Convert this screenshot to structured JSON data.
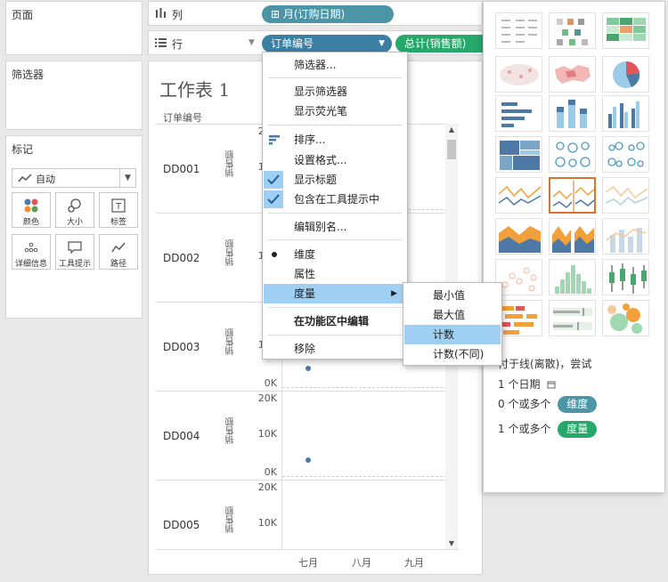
{
  "panels": {
    "pages": "页面",
    "filters": "筛选器",
    "marks": "标记"
  },
  "marks": {
    "type_value": "自动",
    "buttons": [
      {
        "label": "颜色",
        "icon": "color-dots-icon"
      },
      {
        "label": "大小",
        "icon": "size-icon"
      },
      {
        "label": "标签",
        "icon": "label-icon"
      },
      {
        "label": "详细信息",
        "icon": "detail-icon"
      },
      {
        "label": "工具提示",
        "icon": "tooltip-icon"
      },
      {
        "label": "路径",
        "icon": "path-icon"
      }
    ]
  },
  "shelves": {
    "columns_label": "列",
    "rows_label": "行",
    "columns_pill": "⊞ 月(订购日期)",
    "rows_pill": "订单编号",
    "sales_pill": "总计(销售额)"
  },
  "sheet": {
    "title": "工作表 1",
    "row_header": "订单编号",
    "rows": [
      "DD001",
      "DD002",
      "DD003",
      "DD004",
      "DD005"
    ],
    "axis_title": "销售额",
    "axis_ticks": [
      "20K",
      "10K",
      "0K"
    ],
    "months": [
      "七月",
      "八月",
      "九月"
    ]
  },
  "context_menu": {
    "items": [
      {
        "label": "筛选器..."
      },
      {
        "label": "显示筛选器"
      },
      {
        "label": "显示荧光笔"
      },
      {
        "label": "排序..."
      },
      {
        "label": "设置格式..."
      },
      {
        "label": "显示标题",
        "checked": true
      },
      {
        "label": "包含在工具提示中",
        "checked": true
      },
      {
        "label": "编辑别名..."
      },
      {
        "label": "维度",
        "bullet": true
      },
      {
        "label": "属性"
      },
      {
        "label": "度量",
        "submenu": true
      },
      {
        "label": "在功能区中编辑"
      },
      {
        "label": "移除"
      }
    ]
  },
  "sub_menu": {
    "items": [
      "最小值",
      "最大值",
      "计数",
      "计数(不同)"
    ],
    "active_index": 2
  },
  "show_me": {
    "hint_line1": "付于线(离散)，尝试",
    "hint_date": "1 个日期",
    "hint_dims_prefix": "0 个或多个",
    "hint_dims_pill": "维度",
    "hint_meas_prefix": "1 个或多个",
    "hint_meas_pill": "度量"
  },
  "colors": {
    "dimension_pill": "#3b7fa4",
    "measure_pill": "#27a86b",
    "menu_highlight": "#9fd0f4",
    "selected_chart_border": "#e1702f"
  }
}
